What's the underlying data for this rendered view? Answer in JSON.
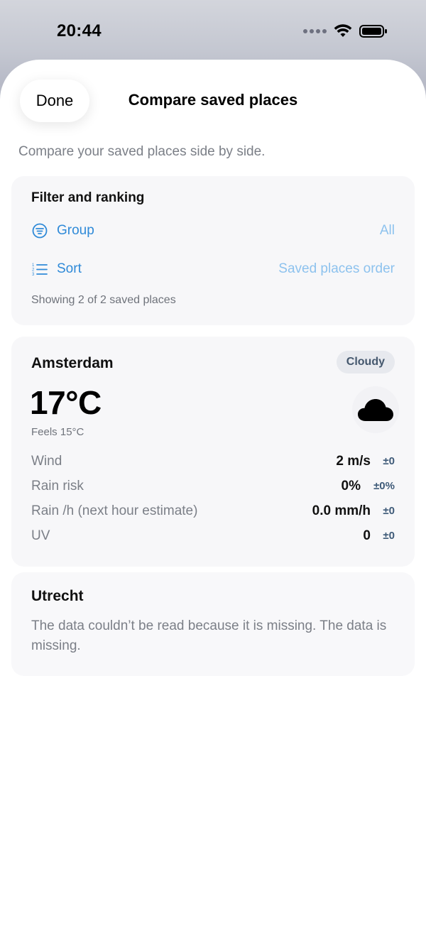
{
  "status_bar": {
    "time": "20:44",
    "icons": [
      "signal-dots-icon",
      "wifi-icon",
      "battery-icon"
    ]
  },
  "header": {
    "done_label": "Done",
    "title": "Compare saved places"
  },
  "subtitle": "Compare your saved places side by side.",
  "filter": {
    "heading": "Filter and ranking",
    "group_label": "Group",
    "group_value": "All",
    "sort_label": "Sort",
    "sort_value": "Saved places order",
    "count_text": "Showing 2 of 2 saved places"
  },
  "places": [
    {
      "name": "Amsterdam",
      "condition": "Cloudy",
      "condition_icon": "cloud-icon",
      "temperature": "17°C",
      "feels_like": "Feels 15°C",
      "metrics": [
        {
          "label": "Wind",
          "value": "2 m/s",
          "delta": "±0"
        },
        {
          "label": "Rain risk",
          "value": "0%",
          "delta": "±0%"
        },
        {
          "label": "Rain /h (next hour estimate)",
          "value": "0.0 mm/h",
          "delta": "±0"
        },
        {
          "label": "UV",
          "value": "0",
          "delta": "±0"
        }
      ]
    },
    {
      "name": "Utrecht",
      "error_message": "The data couldn’t be read because it is missing. The data is missing."
    }
  ],
  "colors": {
    "accent": "#2f8ad8",
    "accent_light": "#8dc2ee",
    "secondary_text": "#7b7f87",
    "badge_text": "#44576d",
    "delta_text": "#3e5a78"
  }
}
